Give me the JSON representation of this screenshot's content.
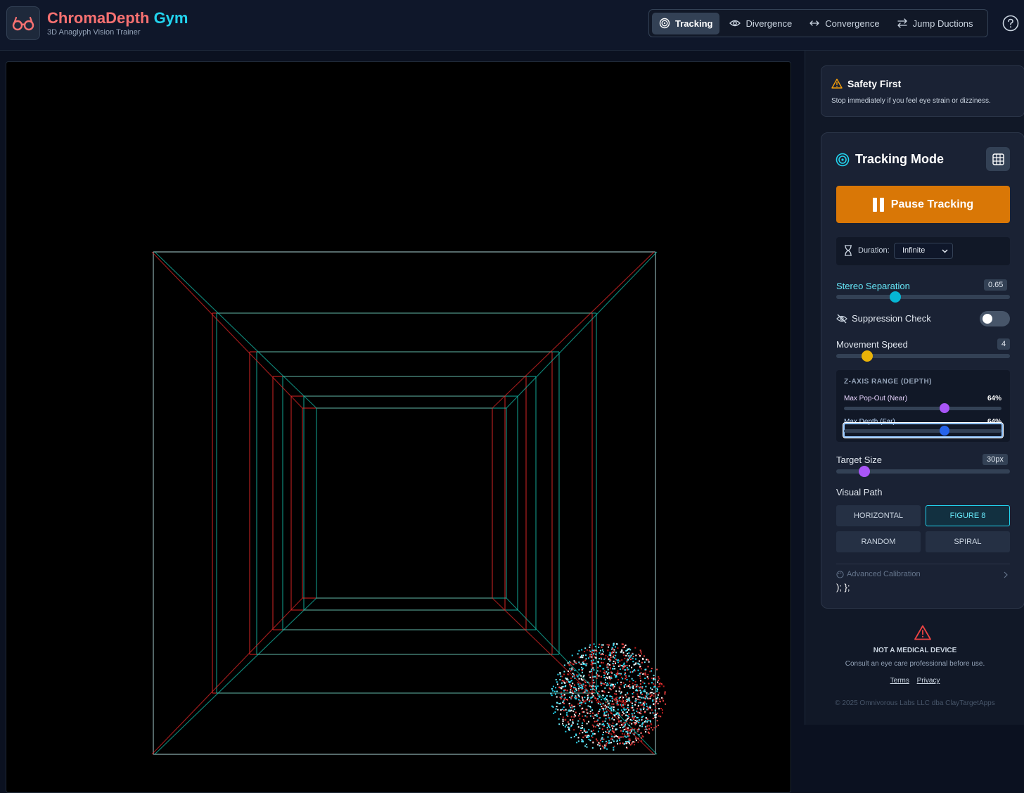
{
  "app": {
    "title_part1": "Chroma",
    "title_part2": "Depth",
    "title_part3": " Gym",
    "subtitle": "3D Anaglyph Vision Trainer"
  },
  "nav": {
    "tabs": [
      {
        "label": "Tracking",
        "icon": "target-icon",
        "active": true
      },
      {
        "label": "Divergence",
        "icon": "eye-icon",
        "active": false
      },
      {
        "label": "Convergence",
        "icon": "arrows-horizontal-icon",
        "active": false
      },
      {
        "label": "Jump Ductions",
        "icon": "swap-icon",
        "active": false
      }
    ],
    "help_icon": "help-circle-icon"
  },
  "safety": {
    "title": "Safety First",
    "text": "Stop immediately if you feel eye strain or dizziness."
  },
  "panel": {
    "title": "Tracking Mode",
    "pause_label": "Pause Tracking",
    "duration_label": "Duration:",
    "duration_value": "Infinite",
    "stereo_label": "Stereo Separation",
    "stereo_value": "0.65",
    "stereo_fraction": 0.34,
    "suppression_label": "Suppression Check",
    "suppression_on": false,
    "speed_label": "Movement Speed",
    "speed_value": "4",
    "speed_fraction": 0.18,
    "z_title": "Z-AXIS RANGE (DEPTH)",
    "near_label": "Max Pop-Out (Near)",
    "near_value": "64%",
    "near_fraction": 0.64,
    "far_label": "Max Depth (Far)",
    "far_value": "64%",
    "far_fraction": 0.64,
    "target_label": "Target Size",
    "target_value": "30px",
    "target_fraction": 0.16,
    "path_label": "Visual Path",
    "paths": [
      {
        "label": "HORIZONTAL",
        "active": false
      },
      {
        "label": "FIGURE 8",
        "active": true
      },
      {
        "label": "RANDOM",
        "active": false
      },
      {
        "label": "SPIRAL",
        "active": false
      }
    ],
    "advanced_label": "Advanced Calibration",
    "stray_text": "); };"
  },
  "footer": {
    "title": "NOT A MEDICAL DEVICE",
    "subtitle": "Consult an eye care professional before use.",
    "terms": "Terms",
    "privacy": "Privacy",
    "copyright": "© 2025 Omnivorous Labs LLC dba ClayTargetApps"
  },
  "colors": {
    "accent_cyan": "#22d3ee",
    "accent_red": "#f87171",
    "pause_orange": "#d97706",
    "stereo_thumb": "#06b6d4",
    "speed_thumb": "#eab308",
    "near_thumb": "#a855f7",
    "far_thumb": "#2563eb",
    "target_thumb": "#a855f7"
  }
}
